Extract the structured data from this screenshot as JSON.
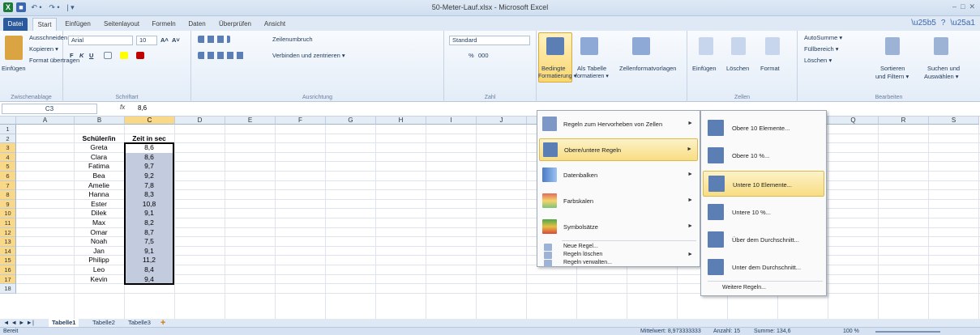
{
  "app": {
    "title": "50-Meter-Lauf.xlsx - Microsoft Excel",
    "window_controls": [
      "–",
      "□",
      "✕"
    ]
  },
  "qat": {
    "excel_icon": "X",
    "save_icon": "■",
    "undo": "↶ •",
    "redo": "↷ •",
    "customize": "| ▾"
  },
  "tabs": [
    {
      "label": "Datei"
    },
    {
      "label": "Start"
    },
    {
      "label": "Einfügen"
    },
    {
      "label": "Seitenlayout"
    },
    {
      "label": "Formeln"
    },
    {
      "label": "Daten"
    },
    {
      "label": "Überprüfen"
    },
    {
      "label": "Ansicht"
    }
  ],
  "ribbon": {
    "clipboard": {
      "paste": "Einfügen",
      "cut": "Ausschneiden",
      "copy": "Kopieren ▾",
      "format_painter": "Format übertragen",
      "group": "Zwischenablage"
    },
    "font": {
      "name": "Arial",
      "size": "10",
      "grow": "A˄",
      "shrink": "A˅",
      "bold": "F",
      "italic": "K",
      "underline": "U",
      "group": "Schriftart"
    },
    "alignment": {
      "wrap": "Zeilenumbruch",
      "merge": "Verbinden und zentrieren ▾",
      "group": "Ausrichtung"
    },
    "number": {
      "format": "Standard",
      "percent": "%",
      "thousands": "000",
      "group": "Zahl"
    },
    "styles": {
      "conditional": "Bedingte",
      "conditional2": "Formatierung ▾",
      "as_table": "Als Tabelle",
      "as_table2": "formatieren ▾",
      "cell_styles": "Zellenformatvorlagen"
    },
    "cells": {
      "insert": "Einfügen",
      "delete": "Löschen",
      "format": "Format",
      "group": "Zellen"
    },
    "editing": {
      "autosum": "AutoSumme ▾",
      "fill": "Füllbereich ▾",
      "clear": "Löschen ▾",
      "sort": "Sortieren",
      "sort2": "und Filtern ▾",
      "find": "Suchen und",
      "find2": "Auswählen ▾",
      "group": "Bearbeiten"
    }
  },
  "formula_bar": {
    "name_box": "C3",
    "fx": "fx",
    "value": "8,6"
  },
  "columns": [
    "A",
    "B",
    "C",
    "D",
    "E",
    "F",
    "G",
    "H",
    "I",
    "J",
    "K",
    "L",
    "M",
    "N",
    "O",
    "P",
    "Q",
    "R",
    "S"
  ],
  "rows": [
    "1",
    "2",
    "3",
    "4",
    "5",
    "6",
    "7",
    "8",
    "9",
    "10",
    "11",
    "12",
    "13",
    "14",
    "15",
    "16",
    "17",
    "18"
  ],
  "table": {
    "header_name": "Schüler/in",
    "header_time": "Zeit in sec",
    "students": [
      {
        "name": "Greta",
        "time": "8,6"
      },
      {
        "name": "Clara",
        "time": "8,6"
      },
      {
        "name": "Fatima",
        "time": "9,7"
      },
      {
        "name": "Bea",
        "time": "9,2"
      },
      {
        "name": "Amelie",
        "time": "7,8"
      },
      {
        "name": "Hanna",
        "time": "8,3"
      },
      {
        "name": "Ester",
        "time": "10,8"
      },
      {
        "name": "Dilek",
        "time": "9,1"
      },
      {
        "name": "Max",
        "time": "8,2"
      },
      {
        "name": "Omar",
        "time": "8,7"
      },
      {
        "name": "Noah",
        "time": "7,5"
      },
      {
        "name": "Jan",
        "time": "9,1"
      },
      {
        "name": "Philipp",
        "time": "11,2"
      },
      {
        "name": "Leo",
        "time": "8,4"
      },
      {
        "name": "Kevin",
        "time": "9,4"
      }
    ]
  },
  "cf_menu": {
    "items": [
      {
        "label": "Regeln zum Hervorheben von Zellen"
      },
      {
        "label": "Obere/untere Regeln"
      },
      {
        "label": "Datenbalken"
      },
      {
        "label": "Farbskalen"
      },
      {
        "label": "Symbolsätze"
      }
    ],
    "small": [
      {
        "label": "Neue Regel..."
      },
      {
        "label": "Regeln löschen"
      },
      {
        "label": "Regeln verwalten..."
      }
    ]
  },
  "sub_menu": {
    "items": [
      {
        "label": "Obere 10 Elemente..."
      },
      {
        "label": "Obere 10 %..."
      },
      {
        "label": "Untere 10 Elemente..."
      },
      {
        "label": "Untere 10 %..."
      },
      {
        "label": "Über dem Durchschnitt..."
      },
      {
        "label": "Unter dem Durchschnitt..."
      }
    ],
    "more": "Weitere Regeln..."
  },
  "sheets": {
    "nav": "◄ ◄ ► ►|",
    "tabs": [
      "Tabelle1",
      "Tabelle2",
      "Tabelle3"
    ]
  },
  "status": {
    "ready": "Bereit",
    "mean": "Mittelwert: 8,973333333",
    "count": "Anzahl: 15",
    "sum": "Summe: 134,6",
    "zoom": "100 %"
  }
}
